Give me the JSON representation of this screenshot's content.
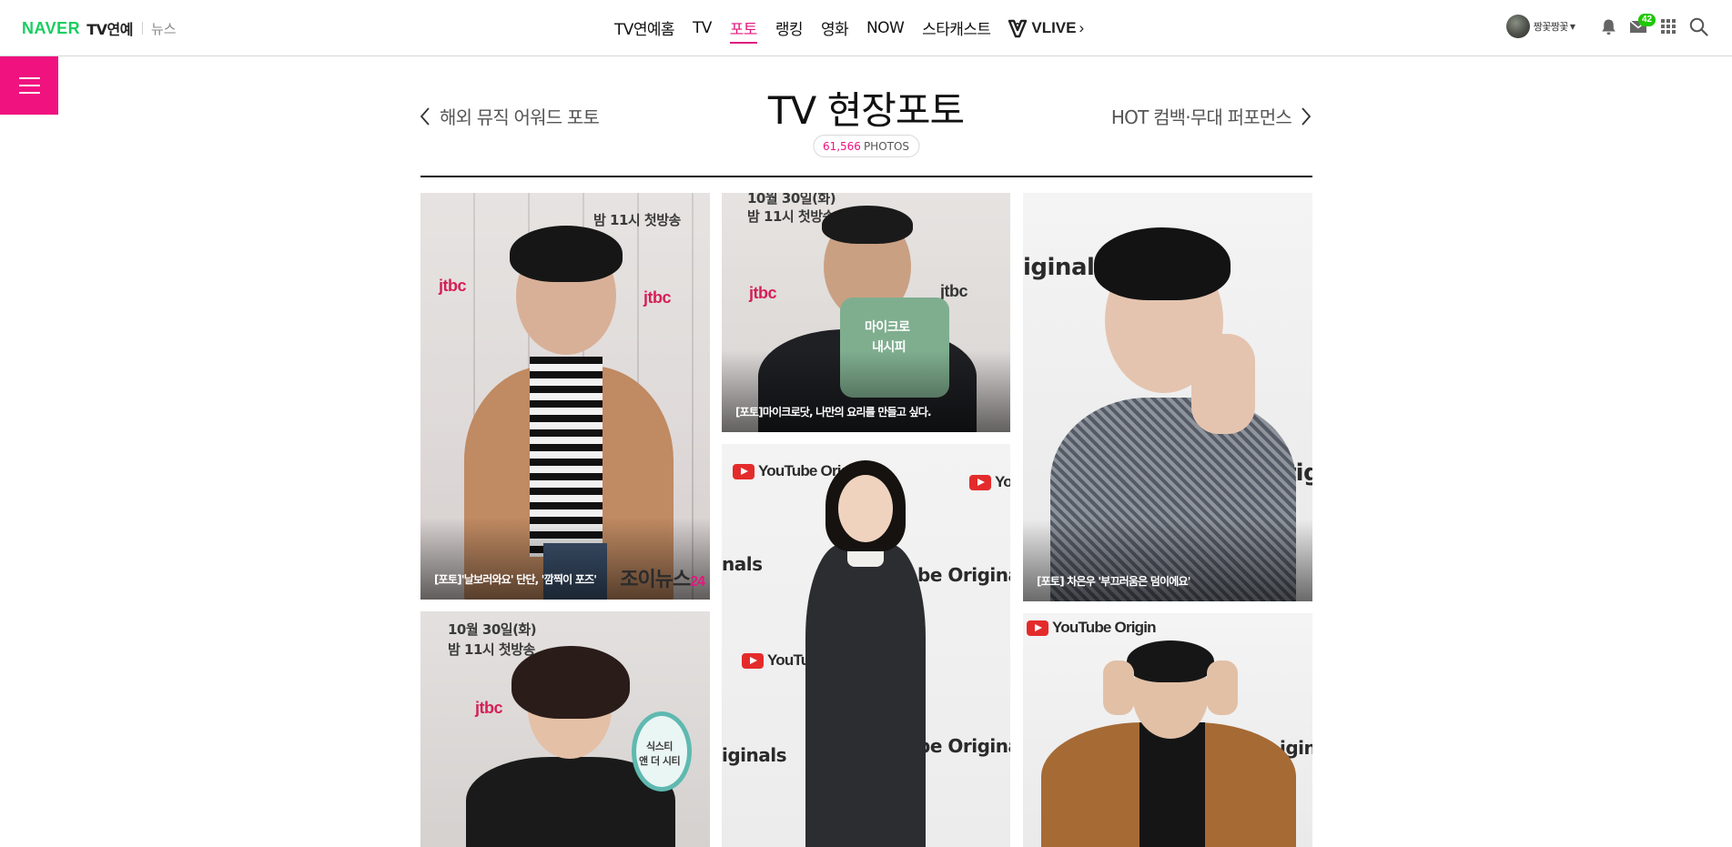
{
  "topbar": {
    "brand": {
      "naver": "NAVER",
      "service": "TV연예",
      "sub": "뉴스"
    },
    "gnb": [
      {
        "label": "TV연예홈",
        "active": false
      },
      {
        "label": "TV",
        "active": false
      },
      {
        "label": "포토",
        "active": true
      },
      {
        "label": "랭킹",
        "active": false
      },
      {
        "label": "영화",
        "active": false
      },
      {
        "label": "NOW",
        "active": false
      },
      {
        "label": "스타캐스트",
        "active": false
      }
    ],
    "vlive": {
      "label": "VLIVE",
      "arrow": "›"
    },
    "user": {
      "name": "짱꽃짱꽃"
    },
    "mail_badge": "42"
  },
  "header": {
    "prev_label": "해외 뮤직 어워드 포토",
    "next_label": "HOT 컴백·무대 퍼포먼스",
    "title": "TV 현장포토",
    "count": "61,566",
    "count_unit": "PHOTOS"
  },
  "photos": [
    {
      "caption": "[포토]'날보러와요' 단단, '깜찍이 포즈'",
      "watermark": "조이뉴스",
      "watermark_num": "24",
      "backdrop_text": "밤 11시 첫방송"
    },
    {
      "caption": "[포토]마이크로닷, 나만의 요리를 만들고 싶다.",
      "backdrop_text_1": "10월 30일(화)",
      "backdrop_text_2": "밤 11시 첫방송",
      "sign_1": "마이크로",
      "sign_2": "내시피",
      "logo": "jtbc"
    },
    {
      "caption": "[포토] 차은우 '부끄러움은 덤이에요'",
      "backdrop_text_1": "iginals",
      "backdrop_text_2": "e Origi"
    },
    {
      "caption": "",
      "backdrop_text_1": "10월 30일(화)",
      "backdrop_text_2": "밤 11시 첫방송",
      "sign_1": "식스티",
      "sign_2": "앤 더 시티"
    },
    {
      "caption": "",
      "yt_1": "YouTube Origi",
      "yt_2": "YouTube O",
      "yt_3": "YouTube O",
      "originals_1": "nals",
      "originals_2": "be Originals",
      "originals_3": "iginals",
      "originals_4": "be Originals"
    },
    {
      "caption": "",
      "yt_1": "YouTube Origin",
      "originals_1": "igin"
    }
  ],
  "colors": {
    "accent": "#f0127f",
    "naver_green": "#19ce60",
    "active_menu": "#e0197d"
  }
}
